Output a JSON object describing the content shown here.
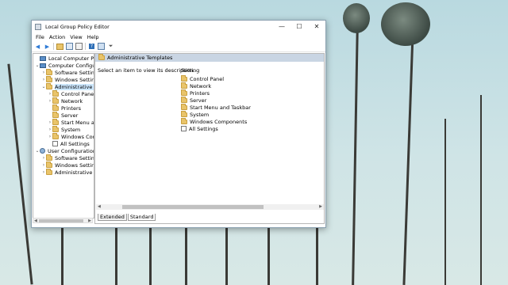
{
  "window": {
    "title": "Local Group Policy Editor",
    "controls": {
      "minimize": "—",
      "maximize": "☐",
      "close": "✕"
    }
  },
  "menubar": {
    "items": [
      "File",
      "Action",
      "View",
      "Help"
    ]
  },
  "tree": {
    "items": [
      {
        "label": "Local Computer Policy",
        "expander": "",
        "icon": "computer-icon"
      },
      {
        "label": "Computer Configura",
        "expander": "⌄",
        "icon": "computer-icon"
      },
      {
        "label": "Software Settings",
        "expander": "›",
        "icon": "folder-icon"
      },
      {
        "label": "Windows Setting",
        "expander": "›",
        "icon": "folder-icon"
      },
      {
        "label": "Administrative Te",
        "expander": "⌄",
        "icon": "folder-icon",
        "selected": true
      },
      {
        "label": "Control Panel",
        "expander": "›",
        "icon": "folder-icon"
      },
      {
        "label": "Network",
        "expander": "›",
        "icon": "folder-icon"
      },
      {
        "label": "Printers",
        "expander": "",
        "icon": "folder-icon"
      },
      {
        "label": "Server",
        "expander": "",
        "icon": "folder-icon"
      },
      {
        "label": "Start Menu ar",
        "expander": "›",
        "icon": "folder-icon"
      },
      {
        "label": "System",
        "expander": "›",
        "icon": "folder-icon"
      },
      {
        "label": "Windows Cor",
        "expander": "›",
        "icon": "folder-icon"
      },
      {
        "label": "All Settings",
        "expander": "",
        "icon": "settings-icon"
      },
      {
        "label": "User Configuration",
        "expander": "⌄",
        "icon": "user-icon"
      },
      {
        "label": "Software Settings",
        "expander": "›",
        "icon": "folder-icon"
      },
      {
        "label": "Windows Setting",
        "expander": "›",
        "icon": "folder-icon"
      },
      {
        "label": "Administrative Te",
        "expander": "›",
        "icon": "folder-icon"
      }
    ]
  },
  "right": {
    "header": "Administrative Templates",
    "description": "Select an item to view its description.",
    "column": "Setting",
    "items": [
      {
        "label": "Control Panel",
        "icon": "folder-icon"
      },
      {
        "label": "Network",
        "icon": "folder-icon"
      },
      {
        "label": "Printers",
        "icon": "folder-icon"
      },
      {
        "label": "Server",
        "icon": "folder-icon"
      },
      {
        "label": "Start Menu and Taskbar",
        "icon": "folder-icon"
      },
      {
        "label": "System",
        "icon": "folder-icon"
      },
      {
        "label": "Windows Components",
        "icon": "folder-icon"
      },
      {
        "label": "All Settings",
        "icon": "settings-icon"
      }
    ]
  },
  "tabs": [
    "Extended",
    "Standard"
  ]
}
